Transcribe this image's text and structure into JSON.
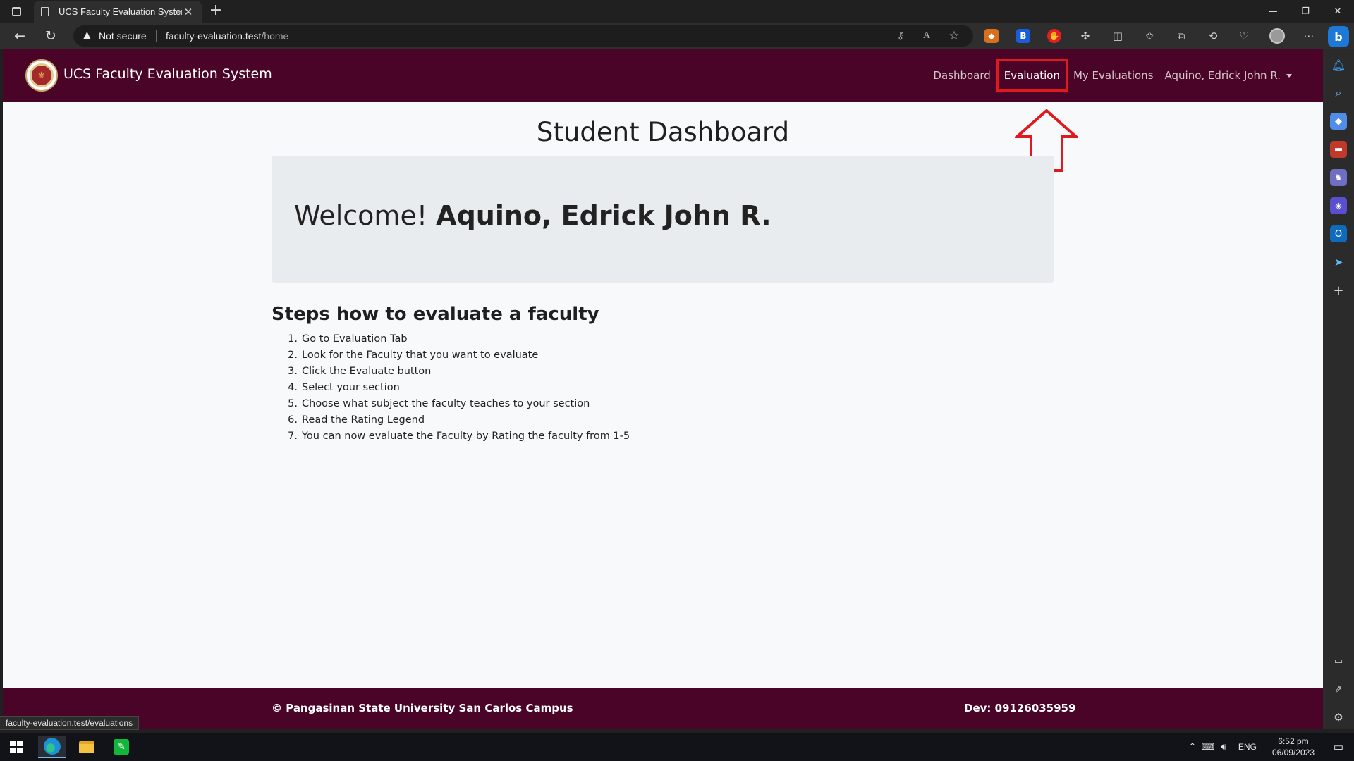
{
  "browser": {
    "tab_title": "UCS Faculty Evaluation System",
    "new_tab_symbol": "+",
    "security_label": "Not secure",
    "url_host": "faculty-evaluation.test",
    "url_path": "/home",
    "status_bar_url": "faculty-evaluation.test/evaluations"
  },
  "navbar": {
    "brand": "UCS Faculty Evaluation System",
    "links": {
      "dashboard": "Dashboard",
      "evaluation": "Evaluation",
      "my_evaluations": "My Evaluations",
      "user": "Aquino, Edrick John R."
    },
    "highlight_color": "#e0191f",
    "bg_color": "#4a0427"
  },
  "main": {
    "title": "Student Dashboard",
    "welcome_prefix": "Welcome!",
    "welcome_name": "Aquino, Edrick John R.",
    "steps_title": "Steps how to evaluate a faculty",
    "steps": [
      {
        "num": "1.",
        "text": "Go to Evaluation Tab"
      },
      {
        "num": "2.",
        "text": "Look for the Faculty that you want to evaluate"
      },
      {
        "num": "3.",
        "text": "Click the Evaluate button"
      },
      {
        "num": "4.",
        "text": "Select your section"
      },
      {
        "num": "5.",
        "text": "Choose what subject the faculty teaches to your section"
      },
      {
        "num": "6.",
        "text": "Read the Rating Legend"
      },
      {
        "num": "7.",
        "text": "You can now evaluate the Faculty by Rating the faculty from 1-5"
      }
    ]
  },
  "footer": {
    "left": "© Pangasinan State University San Carlos Campus",
    "right": "Dev: 09126035959"
  },
  "taskbar": {
    "language": "ENG",
    "time": "6:52 pm",
    "date": "06/09/2023"
  }
}
